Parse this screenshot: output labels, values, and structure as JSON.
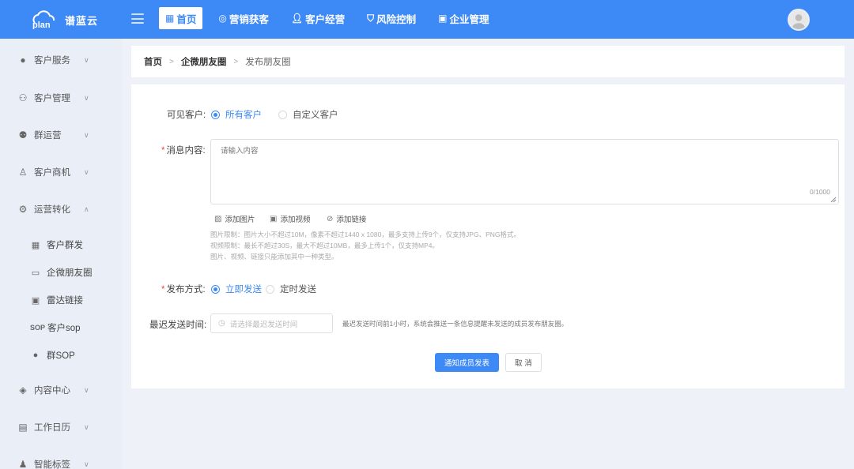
{
  "brand": {
    "name": "谱蓝云",
    "logo_text": "plan"
  },
  "colors": {
    "accent": "#3d8af7",
    "sidebar_bg": "#e9eef7",
    "required": "#e74c3c"
  },
  "nav": {
    "items": [
      {
        "label": "首页",
        "icon": "table-icon",
        "active": true
      },
      {
        "label": "营销获客",
        "icon": "target-icon",
        "active": false
      },
      {
        "label": "客户经营",
        "icon": "user-icon",
        "active": false
      },
      {
        "label": "风险控制",
        "icon": "shield-icon",
        "active": false
      },
      {
        "label": "企业管理",
        "icon": "building-icon",
        "active": false
      }
    ]
  },
  "sidebar": {
    "items": [
      {
        "label": "客户服务",
        "icon": "github-icon"
      },
      {
        "label": "客户管理",
        "icon": "users-icon"
      },
      {
        "label": "群运营",
        "icon": "group-icon"
      },
      {
        "label": "客户商机",
        "icon": "user-money-icon"
      },
      {
        "label": "运营转化",
        "icon": "gear-icon"
      },
      {
        "label": "内容中心",
        "icon": "layers-icon"
      },
      {
        "label": "工作日历",
        "icon": "calendar-icon"
      },
      {
        "label": "智能标签",
        "icon": "tag-user-icon"
      }
    ],
    "subitems": [
      {
        "label": "客户群发",
        "icon": "grid-icon"
      },
      {
        "label": "企微朋友圈",
        "icon": "card-icon"
      },
      {
        "label": "雷达链接",
        "icon": "radar-icon"
      },
      {
        "label": "客户sop",
        "icon": "sop-icon",
        "icon_text": "SOP"
      },
      {
        "label": "群SOP",
        "icon": "chat-icon"
      }
    ]
  },
  "breadcrumb": [
    "首页",
    "企微朋友圈",
    "发布朋友圈"
  ],
  "form": {
    "visible_label": "可见客户:",
    "visible_options": [
      "所有客户",
      "自定义客户"
    ],
    "content_label": "消息内容:",
    "content_placeholder": "请输入内容",
    "content_counter": "0/1000",
    "attachments": [
      "添加图片",
      "添加视频",
      "添加链接"
    ],
    "help_lines": [
      "图片限制：图片大小不超过10M，像素不超过1440 x 1080，最多支持上传9个，仅支持JPG、PNG格式。",
      "视频限制：最长不超过30S，最大不超过10MB，最多上传1个，仅支持MP4。",
      "图片、视频、链接只能添加其中一种类型。"
    ],
    "publish_label": "发布方式:",
    "publish_options": [
      "立即发送",
      "定时发送"
    ],
    "deadline_label": "最迟发送时间:",
    "deadline_placeholder": "请选择最迟发送时间",
    "deadline_note": "最迟发送时间前1小时，系统会推送一条信息提醒未发送的成员发布朋友圈。",
    "submit_label": "通知成员发表",
    "cancel_label": "取 消"
  }
}
